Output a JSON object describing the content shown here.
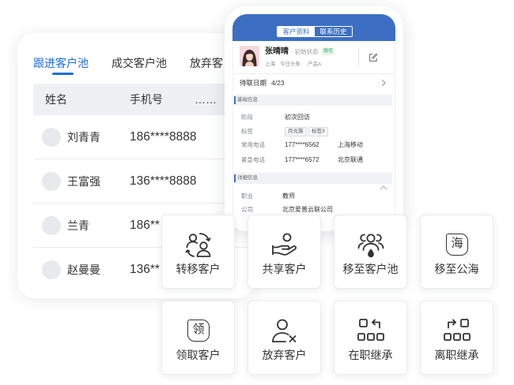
{
  "customer_list": {
    "tabs": [
      {
        "label": "跟进客户池",
        "active": true
      },
      {
        "label": "成交客户池",
        "active": false
      },
      {
        "label": "放弃客",
        "active": false
      }
    ],
    "columns": [
      "姓名",
      "手机号",
      "……"
    ],
    "rows": [
      {
        "name": "刘青青",
        "phone": "186****8888"
      },
      {
        "name": "王富强",
        "phone": "136****8888"
      },
      {
        "name": "兰青",
        "phone": "186**"
      },
      {
        "name": "赵曼曼",
        "phone": "136**"
      }
    ]
  },
  "customer_detail": {
    "tabs": [
      {
        "label": "客户资料",
        "active": true
      },
      {
        "label": "联系历史",
        "active": false
      }
    ],
    "profile": {
      "name": "张晴晴",
      "status": "· 初始状态",
      "badge": "微信",
      "meta": [
        "上海",
        "今日头条",
        "产品A"
      ]
    },
    "next_contact": {
      "label": "待联日期",
      "value": "4/23"
    },
    "basic_info": {
      "title": "基础信息",
      "fields": [
        {
          "label": "阶段",
          "value": "初次回访"
        },
        {
          "label": "标签",
          "tags": [
            "月光族",
            "标签3"
          ]
        },
        {
          "label": "常用电话",
          "value": "177****6562",
          "extra": "上海移动"
        },
        {
          "label": "紧急电话",
          "value": "177****6572",
          "extra": "北京联通"
        }
      ]
    },
    "detail_info": {
      "title": "详细信息",
      "fields": [
        {
          "label": "职业",
          "value": "教师"
        },
        {
          "label": "公司",
          "value": "北京爱普云联公司"
        }
      ]
    }
  },
  "actions": [
    {
      "label": "转移客户",
      "icon": "transfer-users-icon"
    },
    {
      "label": "共享客户",
      "icon": "hand-share-icon"
    },
    {
      "label": "移至客户池",
      "icon": "user-group-pool-icon"
    },
    {
      "label": "移至公海",
      "icon": "sea-glyph-icon",
      "glyph": "海"
    },
    {
      "label": "领取客户",
      "icon": "claim-glyph-icon",
      "glyph": "领"
    },
    {
      "label": "放弃客户",
      "icon": "user-remove-icon"
    },
    {
      "label": "在职继承",
      "icon": "inherit-active-icon"
    },
    {
      "label": "离职继承",
      "icon": "inherit-resigned-icon"
    }
  ],
  "colors": {
    "accent": "#1e6de0",
    "detail_header": "#3c6fc3",
    "badge_green": "#2fb36b",
    "icon_stroke": "#333333"
  }
}
